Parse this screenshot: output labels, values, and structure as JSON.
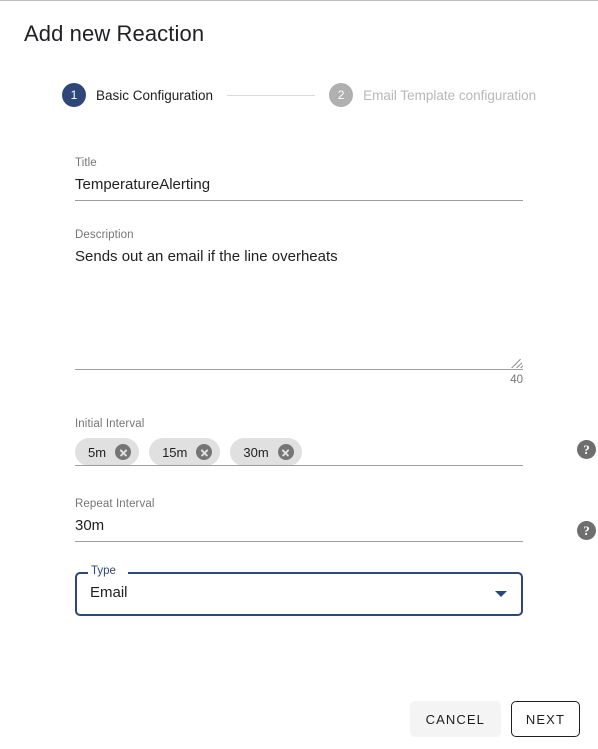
{
  "dialog": {
    "title": "Add new Reaction"
  },
  "stepper": {
    "steps": [
      {
        "number": "1",
        "label": "Basic Configuration",
        "state": "active"
      },
      {
        "number": "2",
        "label": "Email Template configuration",
        "state": "inactive"
      }
    ]
  },
  "form": {
    "title_field": {
      "label": "Title",
      "value": "TemperatureAlerting"
    },
    "description_field": {
      "label": "Description",
      "value": "Sends out an email if the line overheats",
      "char_count": "40"
    },
    "initial_interval_field": {
      "label": "Initial Interval",
      "chips": [
        {
          "label": "5m"
        },
        {
          "label": "15m"
        },
        {
          "label": "30m"
        }
      ],
      "help": "?"
    },
    "repeat_interval_field": {
      "label": "Repeat Interval",
      "value": "30m",
      "help": "?"
    },
    "type_field": {
      "label": "Type",
      "value": "Email"
    }
  },
  "footer": {
    "cancel_label": "CANCEL",
    "next_label": "NEXT"
  },
  "colors": {
    "accent": "#2f4778",
    "inactive_step": "#b0b0b0",
    "chip_bg": "#e0e0e0",
    "help_icon": "#6e6e6e",
    "underline": "#9e9e9e"
  }
}
